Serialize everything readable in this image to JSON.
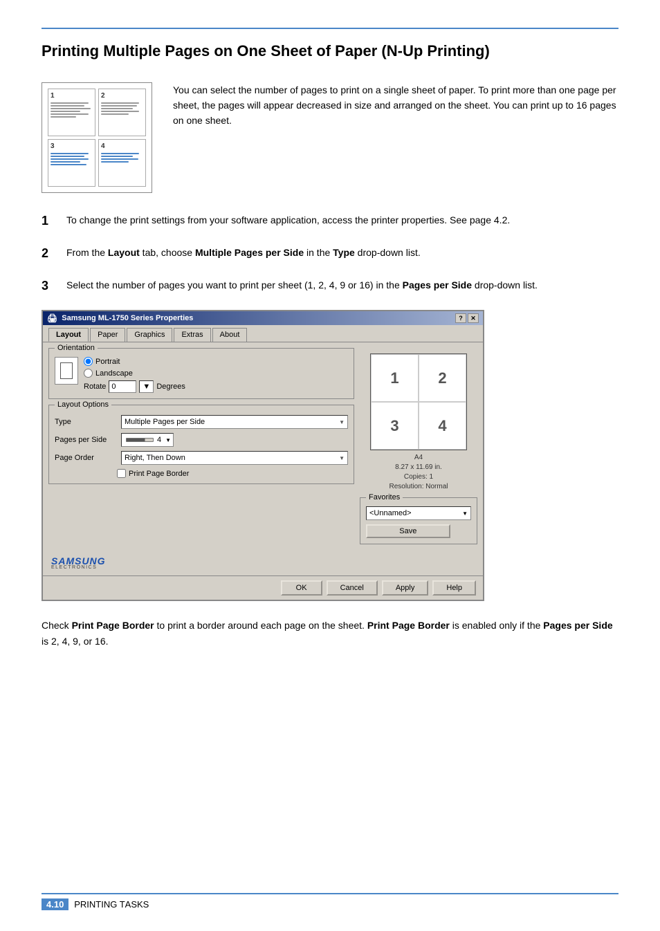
{
  "page": {
    "title": "Printing Multiple Pages on One Sheet of Paper (N-Up Printing)",
    "intro": "You can select the number of pages to print on a single sheet of paper. To print more than one page per sheet, the pages will appear decreased in size and arranged on the sheet. You can print up to 16 pages on one sheet.",
    "steps": [
      {
        "num": "1",
        "text": "To change the print settings from your software application, access the printer properties. See page 4.2."
      },
      {
        "num": "2",
        "text": "From the Layout tab, choose Multiple Pages per Side in the Type drop-down list.",
        "bold_parts": [
          "Layout",
          "Multiple Pages per Side",
          "Type"
        ]
      },
      {
        "num": "3",
        "text": "Select the number of pages you want to print per sheet (1, 2, 4, 9 or 16) in the Pages per Side drop-down list.",
        "bold_parts": [
          "Pages per Side"
        ]
      }
    ],
    "post_step_text": "Check Print Page Border to print a border around each page on the sheet. Print Page Border is enabled only if the Pages per Side is 2, 4, 9, or 16.",
    "post_step_bold": [
      "Print Page Border",
      "Print Page Border",
      "Pages per Side"
    ]
  },
  "dialog": {
    "title": "Samsung ML-1750 Series Properties",
    "tabs": [
      "Layout",
      "Paper",
      "Graphics",
      "Extras",
      "About"
    ],
    "active_tab": "Layout",
    "orientation": {
      "label": "Orientation",
      "options": [
        "Portrait",
        "Landscape"
      ],
      "selected": "Portrait",
      "rotate_label": "Rotate",
      "rotate_value": "0",
      "degrees_label": "Degrees"
    },
    "layout_options": {
      "label": "Layout Options",
      "type_label": "Type",
      "type_value": "Multiple Pages per Side",
      "pages_per_side_label": "Pages per Side",
      "pages_per_side_value": "4",
      "page_order_label": "Page Order",
      "page_order_value": "Right, Then Down",
      "print_page_border_label": "Print Page Border"
    },
    "preview": {
      "cells": [
        "1",
        "2",
        "3",
        "4"
      ],
      "paper_size": "A4",
      "dimensions": "8.27 x 11.69 in.",
      "copies": "Copies: 1",
      "resolution": "Resolution: Normal"
    },
    "favorites": {
      "label": "Favorites",
      "value": "<Unnamed>",
      "save_btn": "Save"
    },
    "footer": {
      "ok": "OK",
      "cancel": "Cancel",
      "apply": "Apply",
      "help": "Help"
    }
  },
  "bottom": {
    "page_num": "4.10",
    "section": "Printing Tasks"
  }
}
